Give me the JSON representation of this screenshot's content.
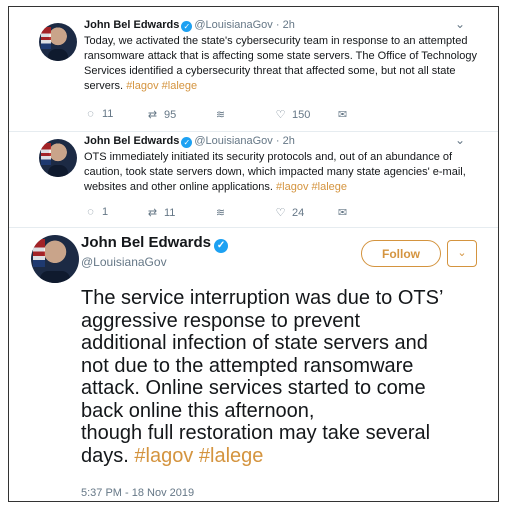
{
  "tweets": [
    {
      "name": "John Bel Edwards",
      "handle": "@LouisianaGov",
      "time": "2h",
      "text": "Today, we activated the state's cybersecurity team in response to an attempted ransomware attack that is affecting some state servers. The Office of Technology Services identified a cybersecurity threat that affected some, but not all state servers.",
      "tags": [
        "#lagov",
        "#lalege"
      ],
      "replies": "11",
      "retweets": "95",
      "likes": "150"
    },
    {
      "name": "John Bel Edwards",
      "handle": "@LouisianaGov",
      "time": "2h",
      "text": "OTS immediately initiated its security protocols and, out of an abundance of caution, took state servers down, which impacted many state agencies' e-mail, websites and other online applications.",
      "tags": [
        "#lagov",
        "#lalege"
      ],
      "replies": "1",
      "retweets": "11",
      "likes": "24"
    }
  ],
  "main": {
    "name": "John Bel Edwards",
    "handle": "@LouisianaGov",
    "follow_label": "Follow",
    "text_lines": [
      "The service interruption was due to OTS’",
      "aggressive response to prevent",
      "additional infection of state servers and",
      "not due to the attempted ransomware",
      "attack. Online services started to come",
      "back online this afternoon,",
      "though full restoration may take several",
      "days."
    ],
    "tags": [
      "#lagov",
      "#lalege"
    ],
    "timestamp": "5:37 PM - 18 Nov 2019"
  },
  "icons": {
    "reply": "reply-icon",
    "retweet": "retweet-icon",
    "stats": "analytics-icon",
    "like": "heart-icon",
    "dm": "envelope-icon",
    "verified": "verified-badge-icon",
    "caret": "chevron-down-icon"
  },
  "colors": {
    "accent": "#d4943f",
    "verified": "#1da1f2",
    "muted": "#657786"
  }
}
